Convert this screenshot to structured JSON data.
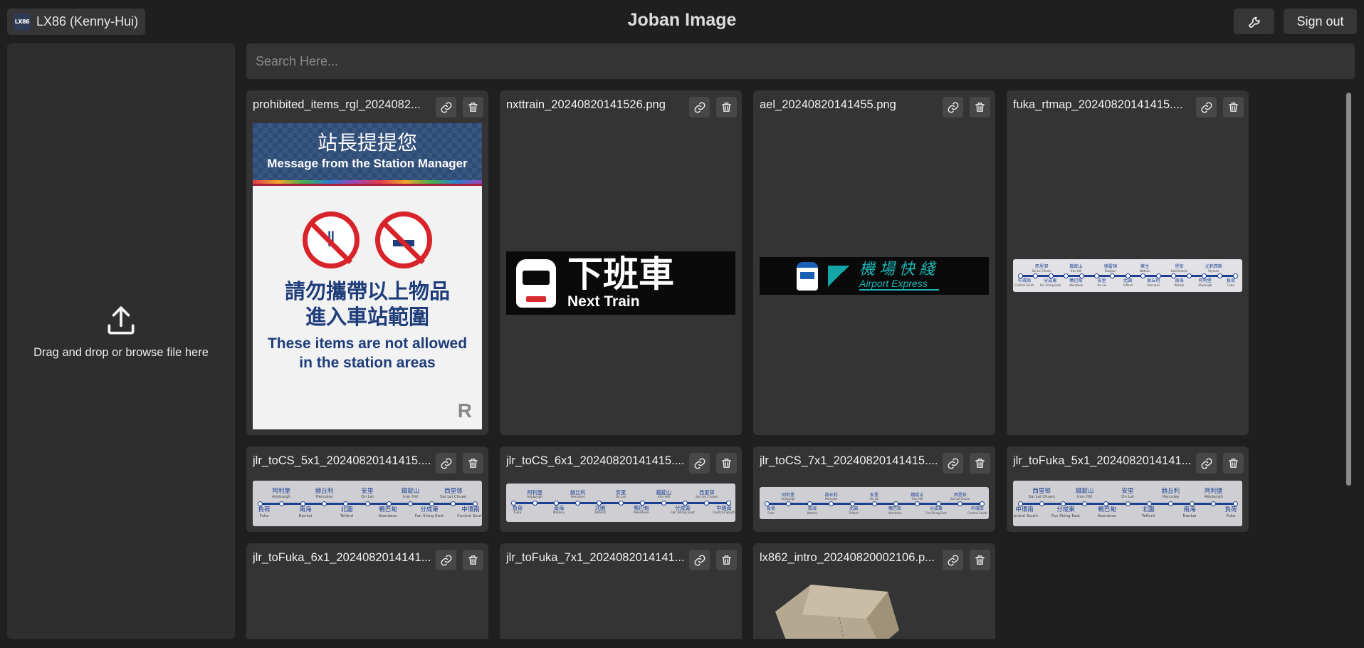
{
  "header": {
    "app_title": "Joban Image",
    "user_logo_text": "LX86",
    "user_name": "LX86 (Kenny-Hui)",
    "settings_icon": "wrench-icon",
    "signout_label": "Sign out"
  },
  "upload": {
    "icon": "upload-icon",
    "text": "Drag and drop or browse file here"
  },
  "search": {
    "placeholder": "Search Here...",
    "value": ""
  },
  "cards": [
    {
      "filename": "prohibited_items_rgl_2024082..."
    },
    {
      "filename": "nxttrain_20240820141526.png"
    },
    {
      "filename": "ael_20240820141455.png"
    },
    {
      "filename": "fuka_rtmap_20240820141415...."
    },
    {
      "filename": "jlr_toCS_5x1_20240820141415...."
    },
    {
      "filename": "jlr_toCS_6x1_20240820141415...."
    },
    {
      "filename": "jlr_toCS_7x1_20240820141415...."
    },
    {
      "filename": "jlr_toFuka_5x1_2024082014141..."
    },
    {
      "filename": "jlr_toFuka_6x1_2024082014141..."
    },
    {
      "filename": "jlr_toFuka_7x1_2024082014141..."
    },
    {
      "filename": "lx862_intro_20240820002106.p..."
    }
  ],
  "card_icons": {
    "link": "link-icon",
    "delete": "trash-icon"
  },
  "thumbnails": {
    "poster": {
      "title_zh": "站長提提您",
      "title_en": "Message from the Station Manager",
      "body_zh_1": "請勿攜帶以上物品",
      "body_zh_2": "進入車站範圍",
      "body_en_1": "These items are not allowed",
      "body_en_2": "in the station areas",
      "logo": "R"
    },
    "next_train": {
      "zh": "下班車",
      "en": "Next Train"
    },
    "airport_express": {
      "zh": "機場快綫",
      "en": "Airport Express"
    },
    "route_to_cs": {
      "top": [
        {
          "zh": "阿利堡",
          "en": "Aliyburgh"
        },
        {
          "zh": "赫丘利",
          "en": "Hercules"
        },
        {
          "zh": "安里",
          "en": "On Lei"
        },
        {
          "zh": "鐵錠山",
          "en": "Iron Hill"
        },
        {
          "zh": "西里邨",
          "en": "Sai Lei Chuen"
        }
      ],
      "bottom": [
        {
          "zh": "負荷",
          "en": "Fuka"
        },
        {
          "zh": "南海",
          "en": "Nankai"
        },
        {
          "zh": "北園",
          "en": "Telford"
        },
        {
          "zh": "鴨巴甸",
          "en": "Aberdeen"
        },
        {
          "zh": "分成東",
          "en": "Fan Shing East"
        },
        {
          "zh": "中環南",
          "en": "Central South"
        }
      ]
    },
    "route_to_fuka": {
      "top": [
        {
          "zh": "西里邨",
          "en": "Sai Lei Chuen"
        },
        {
          "zh": "鐵錠山",
          "en": "Iron Hill"
        },
        {
          "zh": "安里",
          "en": "On Lei"
        },
        {
          "zh": "赫丘利",
          "en": "Hercules"
        },
        {
          "zh": "阿利堡",
          "en": "Aliyburgh"
        }
      ],
      "bottom": [
        {
          "zh": "中環南",
          "en": "Central South"
        },
        {
          "zh": "分成東",
          "en": "Fan Shing East"
        },
        {
          "zh": "鴨巴甸",
          "en": "Aberdeen"
        },
        {
          "zh": "北園",
          "en": "Telford"
        },
        {
          "zh": "南海",
          "en": "Nankai"
        },
        {
          "zh": "負荷",
          "en": "Fuka"
        }
      ]
    },
    "fuka_rtmap": {
      "top": [
        {
          "zh": "西里邨",
          "en": "Sai Lei Chuen"
        },
        {
          "zh": "鐵錠山",
          "en": "Iron Hill"
        },
        {
          "zh": "德雷頓",
          "en": "Drayton"
        },
        {
          "zh": "華生",
          "en": "Watson"
        },
        {
          "zh": "星街",
          "en": "Hoshimachi"
        },
        {
          "zh": "尤莉西斯",
          "en": "Ulysses"
        }
      ],
      "bottom": [
        {
          "zh": "中環南",
          "en": "Central South"
        },
        {
          "zh": "分成東",
          "en": "Fan Shing East"
        },
        {
          "zh": "鴨巴甸",
          "en": "Aberdeen"
        },
        {
          "zh": "安里",
          "en": "On Lei"
        },
        {
          "zh": "北園",
          "en": "Telford"
        },
        {
          "zh": "赫丘利",
          "en": "Hercules"
        },
        {
          "zh": "南海",
          "en": "Nankai"
        },
        {
          "zh": "阿利堡",
          "en": "Aliyburgh"
        },
        {
          "zh": "負荷",
          "en": "Fuka"
        }
      ]
    }
  }
}
